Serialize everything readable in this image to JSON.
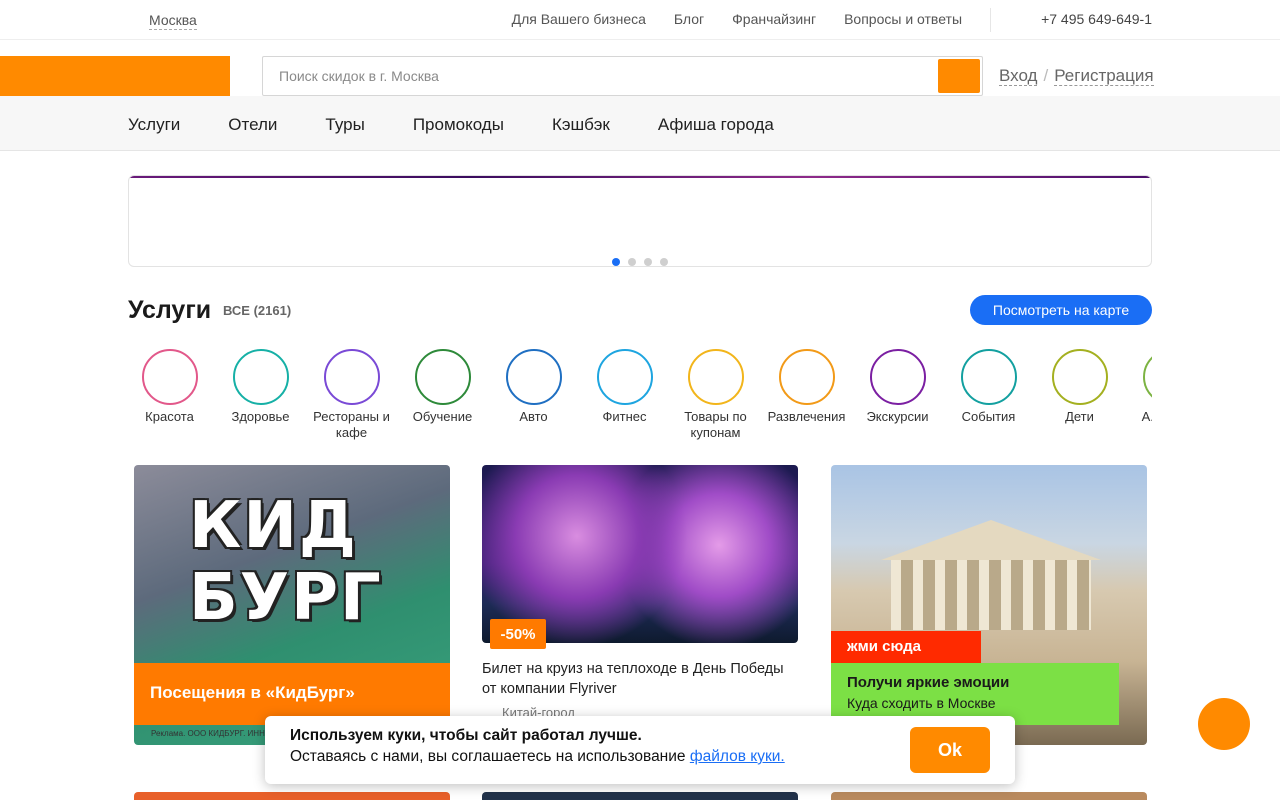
{
  "topbar": {
    "city": "Москва",
    "links": [
      "Для Вашего бизнеса",
      "Блог",
      "Франчайзинг",
      "Вопросы и ответы"
    ],
    "phone": "+7 495 649-649-1"
  },
  "header": {
    "search_placeholder": "Поиск скидок в г. Москва",
    "login": "Вход",
    "separator": "/",
    "register": "Регистрация"
  },
  "nav": {
    "items": [
      "Услуги",
      "Отели",
      "Туры",
      "Промокоды",
      "Кэшбэк",
      "Афиша города"
    ]
  },
  "banner": {
    "dots": 4,
    "active_dot": 0
  },
  "services": {
    "title": "Услуги",
    "count": "ВСЕ (2161)",
    "map_button": "Посмотреть на карте",
    "categories": [
      {
        "label": "Красота",
        "color": "#e2588a"
      },
      {
        "label": "Здоровье",
        "color": "#16b0a6"
      },
      {
        "label": "Рестораны и кафе",
        "color": "#7a4ad6"
      },
      {
        "label": "Обучение",
        "color": "#2e8a3a"
      },
      {
        "label": "Авто",
        "color": "#1f6fc2"
      },
      {
        "label": "Фитнес",
        "color": "#1ea5e0"
      },
      {
        "label": "Товары по купонам",
        "color": "#f2b51b"
      },
      {
        "label": "Развлечения",
        "color": "#f29a18"
      },
      {
        "label": "Экскурсии",
        "color": "#7b1fa2"
      },
      {
        "label": "События",
        "color": "#13a0a0"
      },
      {
        "label": "Дети",
        "color": "#a4b020"
      },
      {
        "label": "А... Под...",
        "color": "#7cb342"
      }
    ]
  },
  "cards": [
    {
      "image_title": "КИД БУРГ",
      "strip_text": "Посещения в «КидБург»",
      "ad_text": "Реклама. ООО КИДБУРГ. ИНН"
    },
    {
      "discount": "-50%",
      "title": "Билет на круиз на теплоходе в День Победы от компании Flyriver",
      "location": "Китай-город"
    },
    {
      "tag": "жми сюда",
      "line1": "Получи яркие эмоции",
      "line2": "Куда сходить в Москве"
    }
  ],
  "cookie": {
    "title": "Используем куки, чтобы сайт работал лучше.",
    "text": "Оставаясь с нами, вы соглашаетесь на использование ",
    "link": "файлов куки.",
    "button": "Ok"
  },
  "colors": {
    "brand": "#ff8a00",
    "accent": "#1a6ef5"
  }
}
